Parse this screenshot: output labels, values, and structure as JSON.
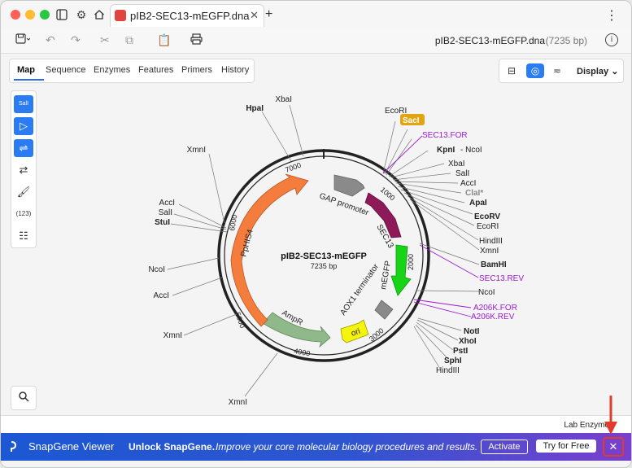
{
  "titlebar": {
    "tab_title": "pIB2-SEC13-mEGFP.dna",
    "new_tab": "+",
    "menu": "⋮"
  },
  "toolbar": {
    "doc_title": "pIB2-SEC13-mEGFP.dna",
    "doc_length": "(7235 bp)",
    "info": "i"
  },
  "views": {
    "tabs": [
      "Map",
      "Sequence",
      "Enzymes",
      "Features",
      "Primers",
      "History"
    ],
    "active": "Map",
    "display_label": "Display"
  },
  "left_tools": {
    "count_label": "(123)",
    "sall_label": "SalI"
  },
  "map": {
    "name": "pIB2-SEC13-mEGFP",
    "length": "7235 bp",
    "tick_labels": [
      "1000",
      "2000",
      "3000",
      "4000",
      "5000",
      "6000",
      "7000"
    ],
    "features": [
      "GAP promoter",
      "SEC13",
      "mEGFP",
      "AOX1 terminator",
      "ori",
      "AmpR",
      "PpHIS4"
    ],
    "right_labels": [
      "EcoRI",
      "SacI",
      "SEC13.FOR",
      "KpnI",
      "- NcoI",
      "XbaI",
      "SalI",
      "AccI",
      "ClaI*",
      "ApaI",
      "EcoRV",
      "EcoRI",
      "HindIII",
      "XmnI",
      "BamHI",
      "SEC13.REV",
      "NcoI",
      "A206K.FOR",
      "A206K.REV",
      "NotI",
      "XhoI",
      "PstI",
      "SphI",
      "HindIII"
    ],
    "left_labels": [
      "XbaI",
      "HpaI",
      "XmnI",
      "AccI",
      "SalI",
      "StuI",
      "NcoI",
      "AccI",
      "XmnI",
      "XmnI"
    ]
  },
  "footer": {
    "lab_enzymes": "Lab Enzymes"
  },
  "banner": {
    "app": "SnapGene Viewer",
    "unlock": "Unlock SnapGene.",
    "subtitle": "Improve your core molecular biology procedures and results.",
    "activate": "Activate",
    "try": "Try for Free",
    "close": "✕"
  },
  "colors": {
    "accent": "#2b7bf3",
    "primer": "#9b1bd1",
    "sec13": "#8e1a5a",
    "egfp": "#17d417",
    "ampr": "#8fb98a",
    "hisq": "#f47c3c",
    "ori": "#f5f40c",
    "sac_badge": "#e3a414"
  }
}
